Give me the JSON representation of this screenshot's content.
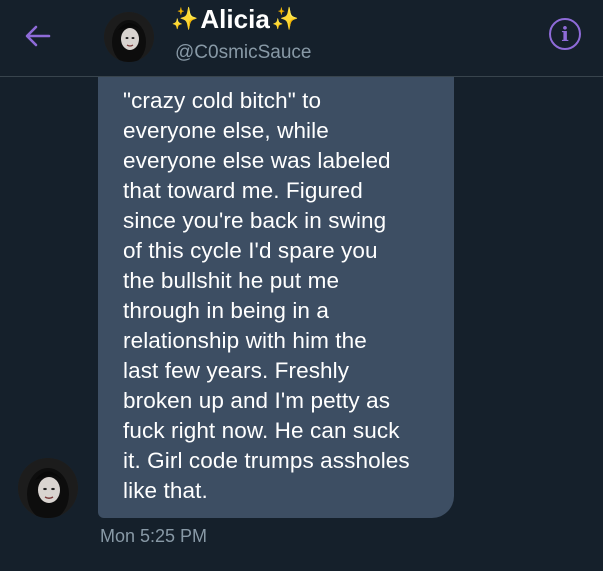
{
  "header": {
    "display_name": "Alicia",
    "sparkle": "✨",
    "handle": "@C0smicSauce",
    "back_icon": "arrow-left-icon",
    "info_icon": "info-icon",
    "accent_color": "#8e6bd8"
  },
  "conversation": {
    "message": {
      "lines": [
        "\"crazy cold bitch\" to",
        "everyone else, while",
        "everyone else was labeled",
        "that toward me. Figured",
        "since you're back in swing",
        "of this cycle I'd spare you",
        "the bullshit he put me",
        "through in being in a",
        "relationship with him the",
        "last few years. Freshly",
        "broken up and I'm petty as",
        "fuck right now. He can suck",
        "it. Girl code trumps assholes",
        "like that."
      ],
      "timestamp": "Mon 5:25 PM"
    }
  },
  "colors": {
    "background": "#15202b",
    "bubble": "#3d4e63",
    "muted_text": "#8899a6"
  }
}
